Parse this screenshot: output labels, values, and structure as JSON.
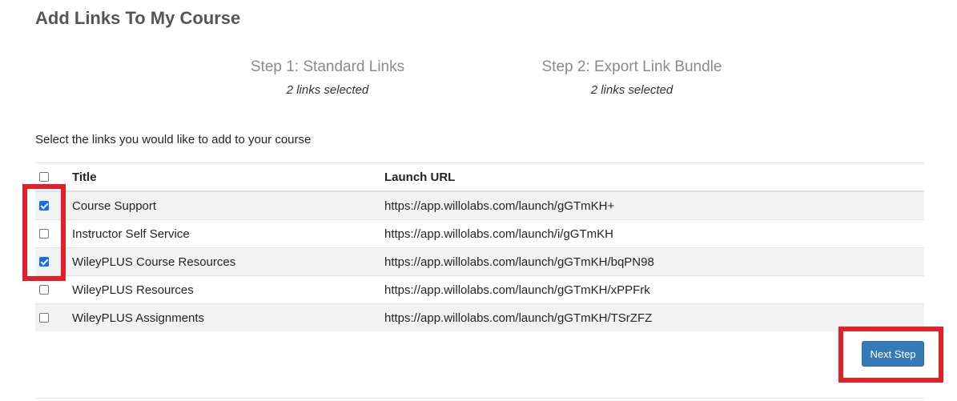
{
  "page": {
    "title": "Add Links To My Course",
    "instruction": "Select the links you would like to add to your course"
  },
  "steps": [
    {
      "title": "Step 1: Standard Links",
      "subtitle": "2 links selected"
    },
    {
      "title": "Step 2: Export Link Bundle",
      "subtitle": "2 links selected"
    }
  ],
  "table": {
    "columns": {
      "title": "Title",
      "url": "Launch URL"
    },
    "select_all_checked": false,
    "rows": [
      {
        "title": "Course Support",
        "url": "https://app.willolabs.com/launch/gGTmKH+",
        "checked": true
      },
      {
        "title": "Instructor Self Service",
        "url": "https://app.willolabs.com/launch/i/gGTmKH",
        "checked": false
      },
      {
        "title": "WileyPLUS Course Resources",
        "url": "https://app.willolabs.com/launch/gGTmKH/bqPN98",
        "checked": true
      },
      {
        "title": "WileyPLUS Resources",
        "url": "https://app.willolabs.com/launch/gGTmKH/xPPFrk",
        "checked": false
      },
      {
        "title": "WileyPLUS Assignments",
        "url": "https://app.willolabs.com/launch/gGTmKH/TSrZFZ",
        "checked": false
      }
    ]
  },
  "actions": {
    "next_label": "Next Step"
  },
  "colors": {
    "highlight": "#e3202a",
    "primary_button": "#337ab7",
    "checkbox_checked": "#0d6efd",
    "row_stripe": "#f2f2f2"
  }
}
